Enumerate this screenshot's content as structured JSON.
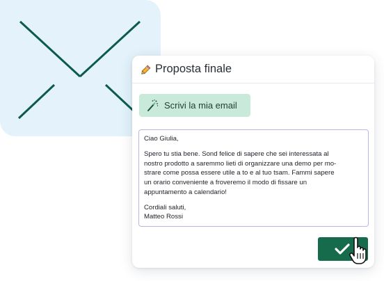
{
  "dialog": {
    "title": "Proposta finale",
    "write_button_label": "Scrivi la mia email"
  },
  "email": {
    "greeting": "Ciao Giulia,",
    "body_lines": [
      "Spero tu stia bene. Sond felice di sapere che sei interessata al",
      "nostro prodotto a saremmo lieti di organizzare una demo per mo-",
      "strare come possa essere utile a to e al tuo tsam. Fammi sapere",
      "un orario conveniente a froveremo il modo di fissare un",
      "appuntamento a calendario!"
    ],
    "closing": "Cordiali saluti,",
    "signature": "Matteo Rossi"
  },
  "icons": {
    "envelope": "envelope-icon",
    "pencil": "pencil-icon",
    "wand": "magic-wand-icon",
    "confirm": "checkmark-icon",
    "cursor": "hand-pointer-cursor-icon"
  },
  "colors": {
    "envelope_background": "#e3f2fb",
    "envelope_stroke": "#0c5a4c",
    "write_button_bg": "#c9eadb",
    "email_border": "#b8b6e4",
    "confirm_button_bg": "#176b4d"
  }
}
